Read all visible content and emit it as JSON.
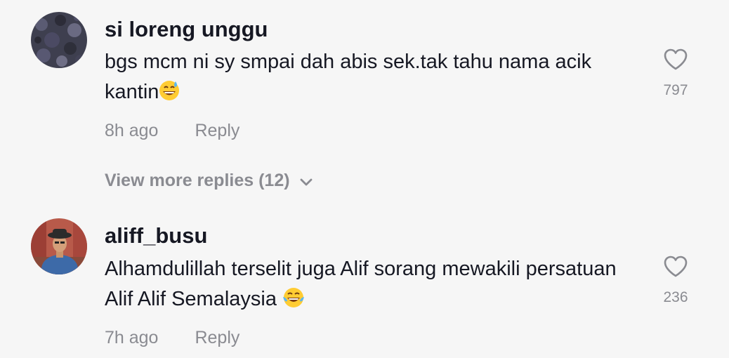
{
  "comments": [
    {
      "username": "si loreng unggu",
      "text": "bgs mcm ni sy smpai dah abis sek.tak tahu nama acik kantin",
      "emoji": "grinning-sweat-icon",
      "time": "8h ago",
      "reply_label": "Reply",
      "likes": "797"
    },
    {
      "username": "aliff_busu",
      "text": "Alhamdulillah terselit juga Alif sorang mewakili persatuan Alif Alif Semalaysia ",
      "emoji": "tears-of-joy-icon",
      "time": "7h ago",
      "reply_label": "Reply",
      "likes": "236"
    }
  ],
  "view_more_replies": "View more replies (12)",
  "colors": {
    "background": "#f6f6f6",
    "primary_text": "#161823",
    "secondary_text": "#8a8b91"
  }
}
